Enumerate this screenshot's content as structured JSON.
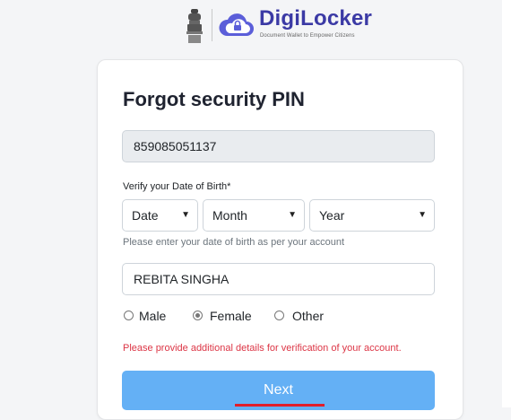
{
  "header": {
    "brand_name": "DigiLocker",
    "tagline": "Document Wallet to Empower Citizens"
  },
  "form": {
    "title": "Forgot security PIN",
    "mobile_value": "859085051137",
    "dob_label": "Verify your Date of Birth*",
    "dob_selects": {
      "date": "Date",
      "month": "Month",
      "year": "Year"
    },
    "dob_hint": "Please enter your date of birth as per your account",
    "name_value": "REBITA SINGHA",
    "gender_options": [
      {
        "label": "Male",
        "checked": false
      },
      {
        "label": "Female",
        "checked": true
      },
      {
        "label": "Other",
        "checked": false
      }
    ],
    "error_message": "Please provide additional details for verification of your account.",
    "next_label": "Next"
  },
  "colors": {
    "brand": "#3b3aa5",
    "button": "#64b0f5",
    "error": "#dc3545",
    "highlight": "#e11d2a"
  }
}
